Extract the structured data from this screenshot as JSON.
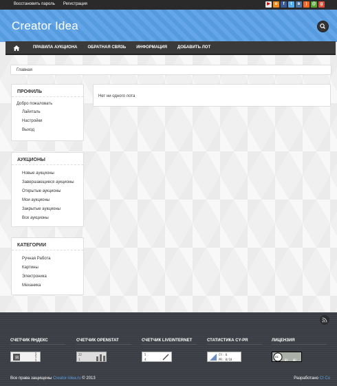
{
  "topbar": {
    "recover_password": "Восстановить пароль",
    "register": "Регистрация",
    "social_icons": [
      "youtube-icon",
      "odnoklassniki-icon",
      "facebook-icon",
      "twitter-icon",
      "vk-icon",
      "rss-icon",
      "mail-icon",
      "google-plus-icon"
    ]
  },
  "header": {
    "logo": "Creator Idea"
  },
  "nav": {
    "items": [
      "ПРАВИЛА АУКЦИОНА",
      "ОБРАТНАЯ СВЯЗЬ",
      "ИНФОРМАЦИЯ",
      "ДОБАВИТЬ ЛОТ"
    ]
  },
  "breadcrumb": {
    "home": "Главная"
  },
  "profile": {
    "title": "ПРОФИЛЬ",
    "welcome": "Добро пожаловать",
    "items": [
      "Лайиталь",
      "Настройки",
      "Выход"
    ]
  },
  "auctions": {
    "title": "АУКЦИОНЫ",
    "items": [
      "Новые аукционы",
      "Завершающиеся аукционы",
      "Открытые аукционы",
      "Мои аукционы",
      "Закрытые аукционы",
      "Все аукционы"
    ]
  },
  "categories": {
    "title": "КАТЕГОРИИ",
    "items": [
      "Ручная Работа",
      "Картины",
      "Электроника",
      "Механика"
    ]
  },
  "main": {
    "empty_text": "Нет ни одного лота"
  },
  "footer": {
    "columns": [
      {
        "title": "СЧЕТЧИК ЯНДЕКС",
        "badge_text": [
          "5",
          "5",
          "5"
        ]
      },
      {
        "title": "СЧЕТЧИК OPENSTAT",
        "badge_text": [
          "22",
          "1"
        ]
      },
      {
        "title": "СЧЕТЧИК LIVEINTERNET",
        "badge_text": [
          "5",
          "4"
        ]
      },
      {
        "title": "СТАТИСТИКА CY-PR",
        "badge_text": [
          "CY: 0",
          "PR: 0/10"
        ]
      },
      {
        "title": "ЛИЦЕНЗИЯ",
        "badge_text": [
          "cc",
          "BY",
          "ND"
        ]
      }
    ],
    "copyright_prefix": "Все права защищены",
    "copyright_link": "Creator-Idea.ru",
    "copyright_suffix": "© 2013",
    "dev_prefix": "Разработано",
    "dev_link": "CI Co"
  },
  "colors": {
    "accent": "#5aa0e6",
    "topbar": "#2a2a2a",
    "nav": "#3a3a3a",
    "footer": "#3b3e44"
  }
}
